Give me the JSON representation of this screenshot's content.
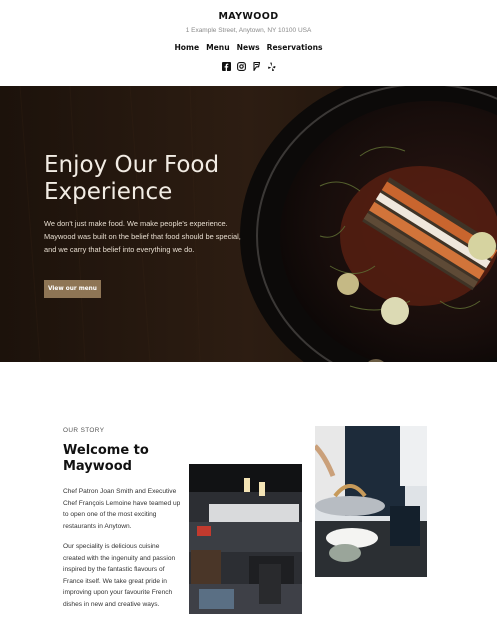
{
  "header": {
    "brand": "MAYWOOD",
    "address": "1 Example Street, Anytown, NY 10100 USA",
    "nav": [
      "Home",
      "Menu",
      "News",
      "Reservations"
    ],
    "social_icons": [
      "facebook-icon",
      "instagram-icon",
      "foursquare-icon",
      "yelp-icon"
    ]
  },
  "hero": {
    "title_line1": "Enjoy Our Food",
    "title_line2": "Experience",
    "text": "We don't just make food. We make people's experience. Maywood was built on the belief that food should be special, and we carry that belief into everything we do.",
    "button_label": "View our menu",
    "button_color": "#8e7555"
  },
  "story": {
    "eyebrow": "OUR STORY",
    "title": "Welcome to Maywood",
    "paragraph1": "Chef Patron Joan Smith and Executive Chef François Lemoine have teamed up to open one of the most exciting restaurants in Anytown.",
    "paragraph2": "Our speciality is delicious cuisine created with the ingenuity and passion inspired by the fantastic flavours of France itself. We take great pride in improving upon your favourite French dishes in new and creative ways."
  }
}
